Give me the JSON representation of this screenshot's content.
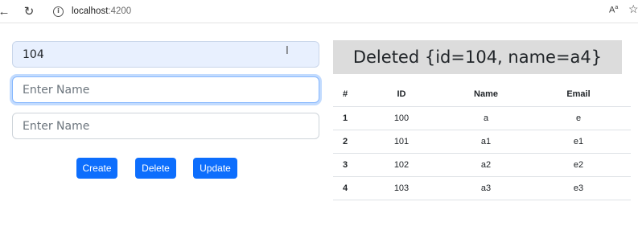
{
  "browser": {
    "url_host": "localhost",
    "url_port": ":4200",
    "read_aloud_label": "A",
    "read_aloud_sup": "a"
  },
  "form": {
    "id_value": "104",
    "name_placeholder": "Enter Name",
    "name2_placeholder": "Enter Name",
    "create_label": "Create",
    "delete_label": "Delete",
    "update_label": "Update"
  },
  "status": {
    "message": "Deleted {id=104, name=a4}"
  },
  "table": {
    "headers": {
      "hash": "#",
      "id": "ID",
      "name": "Name",
      "email": "Email"
    },
    "rows": [
      {
        "num": "1",
        "id": "100",
        "name": "a",
        "email": "e"
      },
      {
        "num": "2",
        "id": "101",
        "name": "a1",
        "email": "e1"
      },
      {
        "num": "3",
        "id": "102",
        "name": "a2",
        "email": "e2"
      },
      {
        "num": "4",
        "id": "103",
        "name": "a3",
        "email": "e3"
      }
    ]
  },
  "colors": {
    "primary": "#0d6efd",
    "banner_bg": "#dcdcdc",
    "autofill_bg": "#e8f0fe",
    "focus_border": "#86b7fe"
  }
}
